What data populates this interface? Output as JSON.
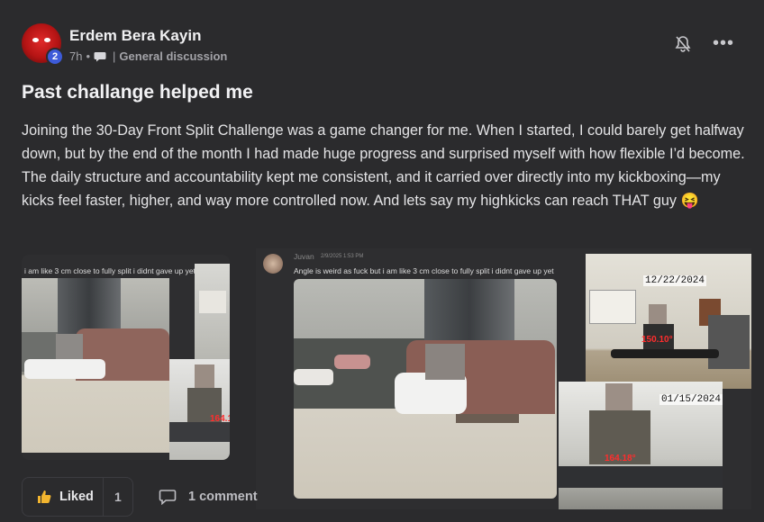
{
  "post": {
    "author": "Erdem Bera Kayin",
    "level": "2",
    "time": "7h",
    "dot": "•",
    "separator": "|",
    "channel": "General discussion",
    "title": "Past challange helped me",
    "body": "Joining the 30-Day Front Split Challenge was a game changer for me. When I started, I could barely get halfway down, but by the end of the month I had made huge progress and surprised myself with how flexible I’d become. The daily structure and accountability kept me consistent, and it carried over directly into my kickboxing—my kicks feel faster, higher, and way more controlled now. And lets say my highkicks can reach THAT guy 😝"
  },
  "images": {
    "left_caption": "i am like 3 cm close to fully split i didnt gave up yet",
    "left_angle": "164.1",
    "chat_user": "Juvan",
    "chat_time": "2/9/2025 1:53 PM",
    "chat_message": "Angle is weird as fuck but i am like 3 cm close to fully split i didnt gave up yet",
    "date_top": "12/22/2024",
    "angle_top": "150.10°",
    "date_bottom": "01/15/2024",
    "angle_bottom": "164.18°"
  },
  "actions": {
    "like_label": "Liked",
    "like_count": "1",
    "comment_label": "1 comment"
  },
  "colors": {
    "background": "#2b2b2d",
    "level_badge": "#3d5bd9",
    "angle_text": "#ff2d2d"
  },
  "icons": [
    "bell-off-icon",
    "more-dots-icon",
    "chat-bubble-icon",
    "thumbs-up-icon",
    "comment-icon"
  ]
}
